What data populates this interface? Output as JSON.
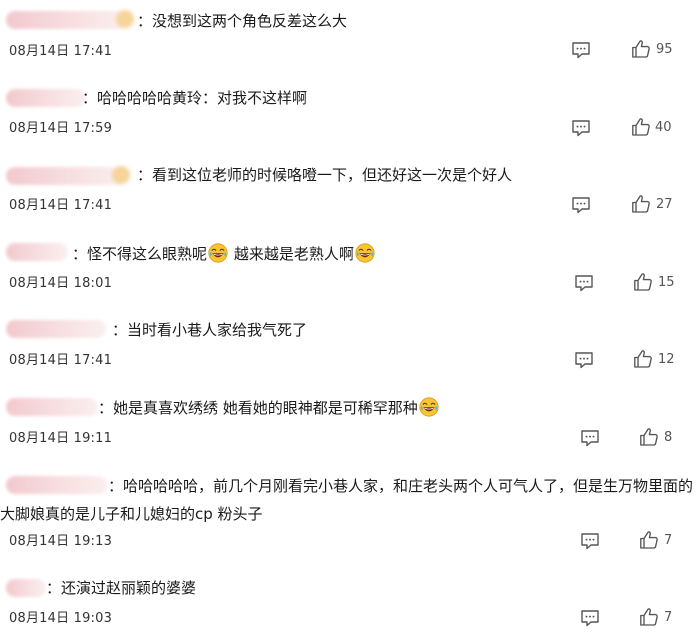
{
  "comments": [
    {
      "text": "没想到这两个角色反差这么大",
      "time": "08月14日 17:41",
      "likes": "95"
    },
    {
      "text": "哈哈哈哈哈黄玲：对我不这样啊",
      "time": "08月14日 17:59",
      "likes": "40"
    },
    {
      "text": "看到这位老师的时候咯噔一下，但还好这一次是个好人",
      "time": "08月14日 17:41",
      "likes": "27"
    },
    {
      "text_a": "怪不得这么眼熟呢",
      "text_b": "越来越是老熟人啊",
      "time": "08月14日 18:01",
      "likes": "15"
    },
    {
      "text": "当时看小巷人家给我气死了",
      "time": "08月14日 17:41",
      "likes": "12"
    },
    {
      "text": "她是真喜欢绣绣 她看她的眼神都是可稀罕那种",
      "time": "08月14日 19:11",
      "likes": "8"
    },
    {
      "text": "哈哈哈哈哈，前几个月刚看完小巷人家，和庄老头两个人可气人了，但是生万物里面的大脚娘真的是儿子和儿媳妇的cp 粉头子",
      "time": "08月14日 19:13",
      "likes": "7"
    },
    {
      "text": "还演过赵丽颖的婆婆",
      "time": "08月14日 19:03",
      "likes": "7"
    }
  ],
  "icons": {
    "reply": "comment-icon",
    "like": "thumbs-up-icon",
    "emoji": "laughing-tears-emoji"
  }
}
